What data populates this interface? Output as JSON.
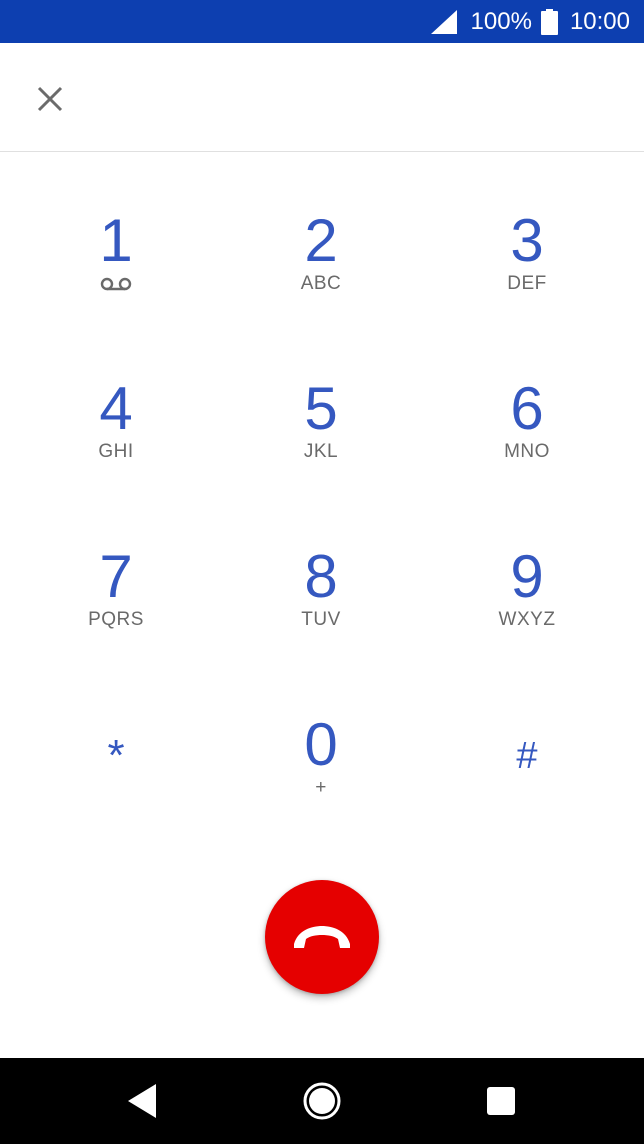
{
  "status_bar": {
    "battery_percent": "100%",
    "time": "10:00",
    "icons": [
      "signal-icon",
      "battery-icon"
    ]
  },
  "top_bar": {
    "close_icon": "close-icon"
  },
  "keypad": {
    "keys": [
      {
        "digit": "1",
        "letters": "",
        "icon": "voicemail-icon"
      },
      {
        "digit": "2",
        "letters": "ABC"
      },
      {
        "digit": "3",
        "letters": "DEF"
      },
      {
        "digit": "4",
        "letters": "GHI"
      },
      {
        "digit": "5",
        "letters": "JKL"
      },
      {
        "digit": "6",
        "letters": "MNO"
      },
      {
        "digit": "7",
        "letters": "PQRS"
      },
      {
        "digit": "8",
        "letters": "TUV"
      },
      {
        "digit": "9",
        "letters": "WXYZ"
      },
      {
        "digit": "*",
        "letters": ""
      },
      {
        "digit": "0",
        "letters": "+"
      },
      {
        "digit": "#",
        "letters": ""
      }
    ]
  },
  "end_call": {
    "icon": "end-call-icon",
    "color": "#e50000"
  },
  "nav_bar": {
    "icons": [
      "back-icon",
      "home-icon",
      "recents-icon"
    ]
  },
  "colors": {
    "status_bar": "#0d3fb0",
    "digit": "#3558c0",
    "letters": "#6a6a6a"
  }
}
